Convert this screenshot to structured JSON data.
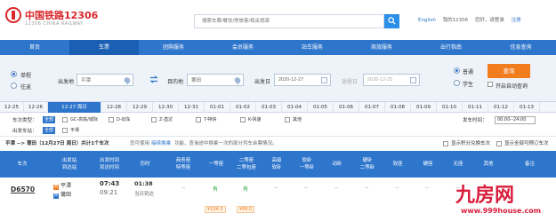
{
  "brand": {
    "name_cn": "中国铁路12306",
    "name_en": "12306 CHINA RAILWAY"
  },
  "header": {
    "search_placeholder": "搜索车票/餐饮/常旅客/相关规章",
    "links": [
      "English",
      "我的12306",
      "您好，请登录",
      "注册"
    ]
  },
  "nav": [
    "首页",
    "车票",
    "团购服务",
    "会员服务",
    "站车服务",
    "商旅服务",
    "出行指南",
    "信息查询"
  ],
  "search": {
    "trip_types": [
      "单程",
      "往返"
    ],
    "from_label": "出发地",
    "from_value": "平潭",
    "to_label": "目的地",
    "to_value": "莆田",
    "depart_label": "出发日",
    "depart_value": "2020-12-27",
    "return_label": "返程日",
    "return_value": "2020-12-25",
    "passenger_types": [
      "普通",
      "学生"
    ],
    "query_label": "查询",
    "auto_query_label": "开启自动查询"
  },
  "date_tabs": [
    "12-25",
    "12-26",
    "12-27 周日",
    "12-28",
    "12-29",
    "12-30",
    "12-31",
    "01-01",
    "01-02",
    "01-03",
    "01-04",
    "01-05",
    "01-06",
    "01-07",
    "01-08",
    "01-09",
    "01-10",
    "01-11",
    "01-12",
    "01-13"
  ],
  "filters": {
    "train_type_label": "车次类型：",
    "all_label": "全部",
    "train_types": [
      "GC-高铁/城际",
      "D-动车",
      "Z-直达",
      "T-特快",
      "K-快速",
      "其他"
    ],
    "depart_station_label": "出发车站：",
    "stations": [
      "平潭"
    ],
    "depart_time_label": "发车时间：",
    "depart_time_value": "00:00--24:00"
  },
  "summary": {
    "route": "平潭 --> 莆田（12月27日 周日）共计1个车次",
    "notice_prefix": "您可使用",
    "notice_link": "接续换乘",
    "notice_suffix": "功能，查询途中换乘一次的部分列车余票情况。",
    "option1": "显示积分兑换车次",
    "option2": "显示全部可预订车次"
  },
  "table": {
    "headers": [
      "车次",
      "出发站\n到达站",
      "出发时间\n到达时间",
      "历时",
      "商务座\n特等座",
      "一等座",
      "二等座\n二等包座",
      "高级\n软卧",
      "软卧\n一等卧",
      "动卧",
      "硬卧\n二等卧",
      "软座",
      "硬座",
      "无座",
      "其他",
      "备注"
    ],
    "rows": [
      {
        "train": "D6570",
        "from": "平潭",
        "to": "莆田",
        "depart": "07:43",
        "arrive": "09:21",
        "duration": "01:38",
        "arrive_day": "当日到达",
        "first_class": "有",
        "second_class": "有",
        "other_seats": [
          "--",
          "--",
          "--",
          "--",
          "--",
          "--",
          "--",
          "--",
          "--"
        ],
        "first_price": "¥104.0",
        "second_price": "¥86.0"
      }
    ]
  },
  "watermark": {
    "logo": "九房网",
    "url": "www.999house.com"
  },
  "colors": {
    "nav": "#2e75cc",
    "accent": "#f27d1f",
    "brand_red": "#d9272b",
    "watermark": "#d81e3c"
  }
}
